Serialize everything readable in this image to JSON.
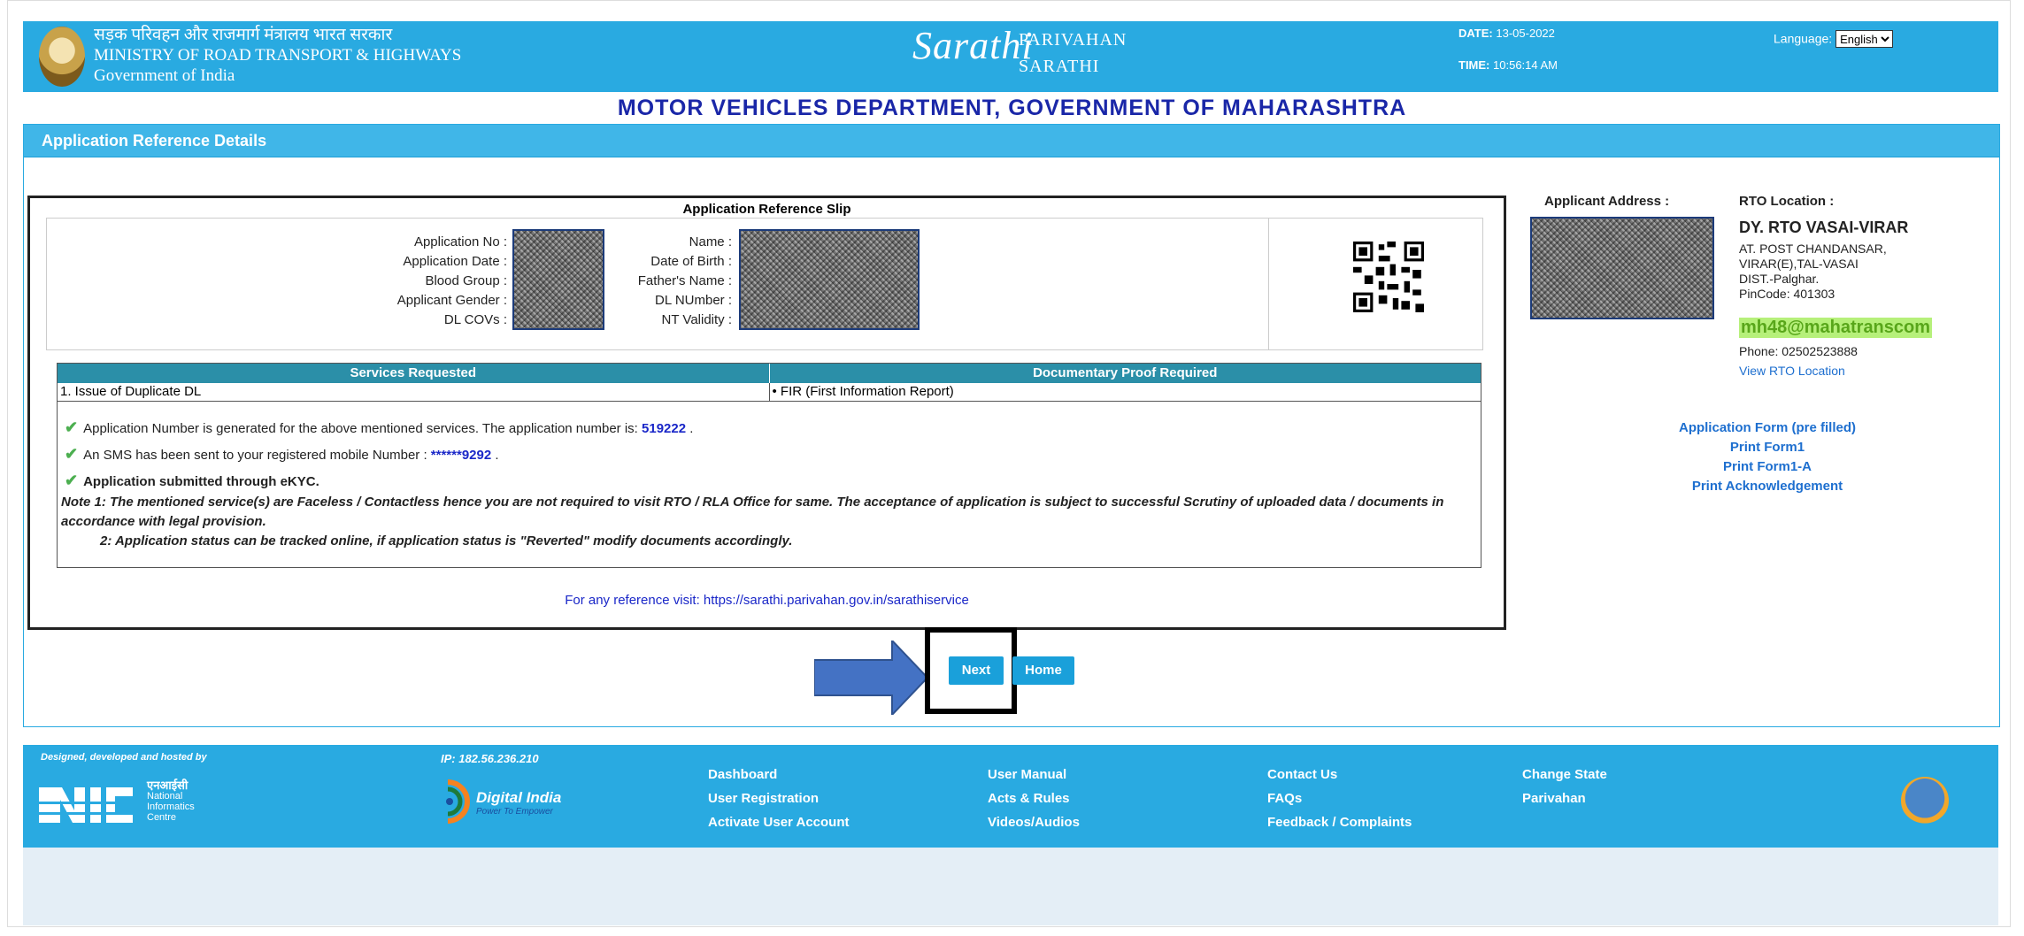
{
  "header": {
    "ministry_hindi": "सड़क परिवहन और राजमार्ग मंत्रालय भारत सरकार",
    "ministry_line1": "MINISTRY OF ROAD TRANSPORT & HIGHWAYS",
    "ministry_line2": "Government of India",
    "logo_big": "Sarathi",
    "logo_parivahan": "PARIVAHAN",
    "logo_sarathi": "SARATHI",
    "date_label": "DATE:",
    "date_value": "13-05-2022",
    "time_label": "TIME:",
    "time_value": "10:56:14 AM",
    "language_label": "Language:",
    "language_value": "English"
  },
  "dept_title": "MOTOR VEHICLES DEPARTMENT, GOVERNMENT OF MAHARASHTRA",
  "panel": {
    "title": "Application Reference Details"
  },
  "slip": {
    "title": "Application Reference Slip",
    "left_labels": [
      "Application No :",
      "Application Date :",
      "Blood Group :",
      "Applicant Gender :",
      "DL COVs :"
    ],
    "right_labels": [
      "Name :",
      "Date of Birth :",
      "Father's Name :",
      "DL NUmber :",
      "NT Validity :"
    ],
    "services_header": "Services Requested",
    "proof_header": "Documentary Proof Required",
    "service_1": "1. Issue of Duplicate DL",
    "proof_1": "• FIR (First Information Report)",
    "msg1_text": "Application Number is generated for the above mentioned services. The application number is:",
    "msg1_value": "519222",
    "msg2_text": "An SMS has been sent to your registered mobile Number :",
    "msg2_value": "******9292",
    "msg3_text": "Application submitted through eKYC.",
    "note1": "Note 1:  The mentioned service(s) are Faceless / Contactless hence you are not required to visit RTO / RLA Office for same. The acceptance of application is subject to successful Scrutiny of uploaded data / documents in accordance with legal provision.",
    "note2": "2:  Application status can be tracked online, if application status is \"Reverted\" modify documents accordingly.",
    "reference_visit": "For any reference visit: https://sarathi.parivahan.gov.in/sarathiservice"
  },
  "applicant_address_label": "Applicant Address :",
  "rto": {
    "label": "RTO Location :",
    "name": "DY. RTO VASAI-VIRAR",
    "addr1": "AT. POST CHANDANSAR,",
    "addr2": "VIRAR(E),TAL-VASAI",
    "addr3": "DIST.-Palghar.",
    "pincode": "PinCode:  401303",
    "email": "mh48@mahatranscom",
    "phone": "Phone:  02502523888",
    "view_location": "View RTO Location"
  },
  "links": {
    "application_form": "Application Form (pre filled)",
    "print_form1": "Print Form1",
    "print_form1a": "Print Form1-A",
    "print_ack": "Print Acknowledgement"
  },
  "buttons": {
    "next": "Next",
    "home": "Home"
  },
  "footer": {
    "designed_by": "Designed, developed and hosted by",
    "ip": "IP: 182.56.236.210",
    "nic_hindi": "एनआईसी",
    "nic_line1": "National",
    "nic_line2": "Informatics",
    "nic_line3": "Centre",
    "digital_india": "Digital India",
    "digital_india_tag": "Power To Empower",
    "col1": [
      "Dashboard",
      "User Registration",
      "Activate User Account"
    ],
    "col2": [
      "User Manual",
      "Acts & Rules",
      "Videos/Audios"
    ],
    "col3": [
      "Contact Us",
      "FAQs",
      "Feedback / Complaints"
    ],
    "col4": [
      "Change State",
      "Parivahan"
    ]
  },
  "colors": {
    "header_blue": "#29aae1",
    "title_blue": "#1a27a8",
    "link_blue": "#1e6fcf",
    "button_blue": "#1aa0da"
  }
}
